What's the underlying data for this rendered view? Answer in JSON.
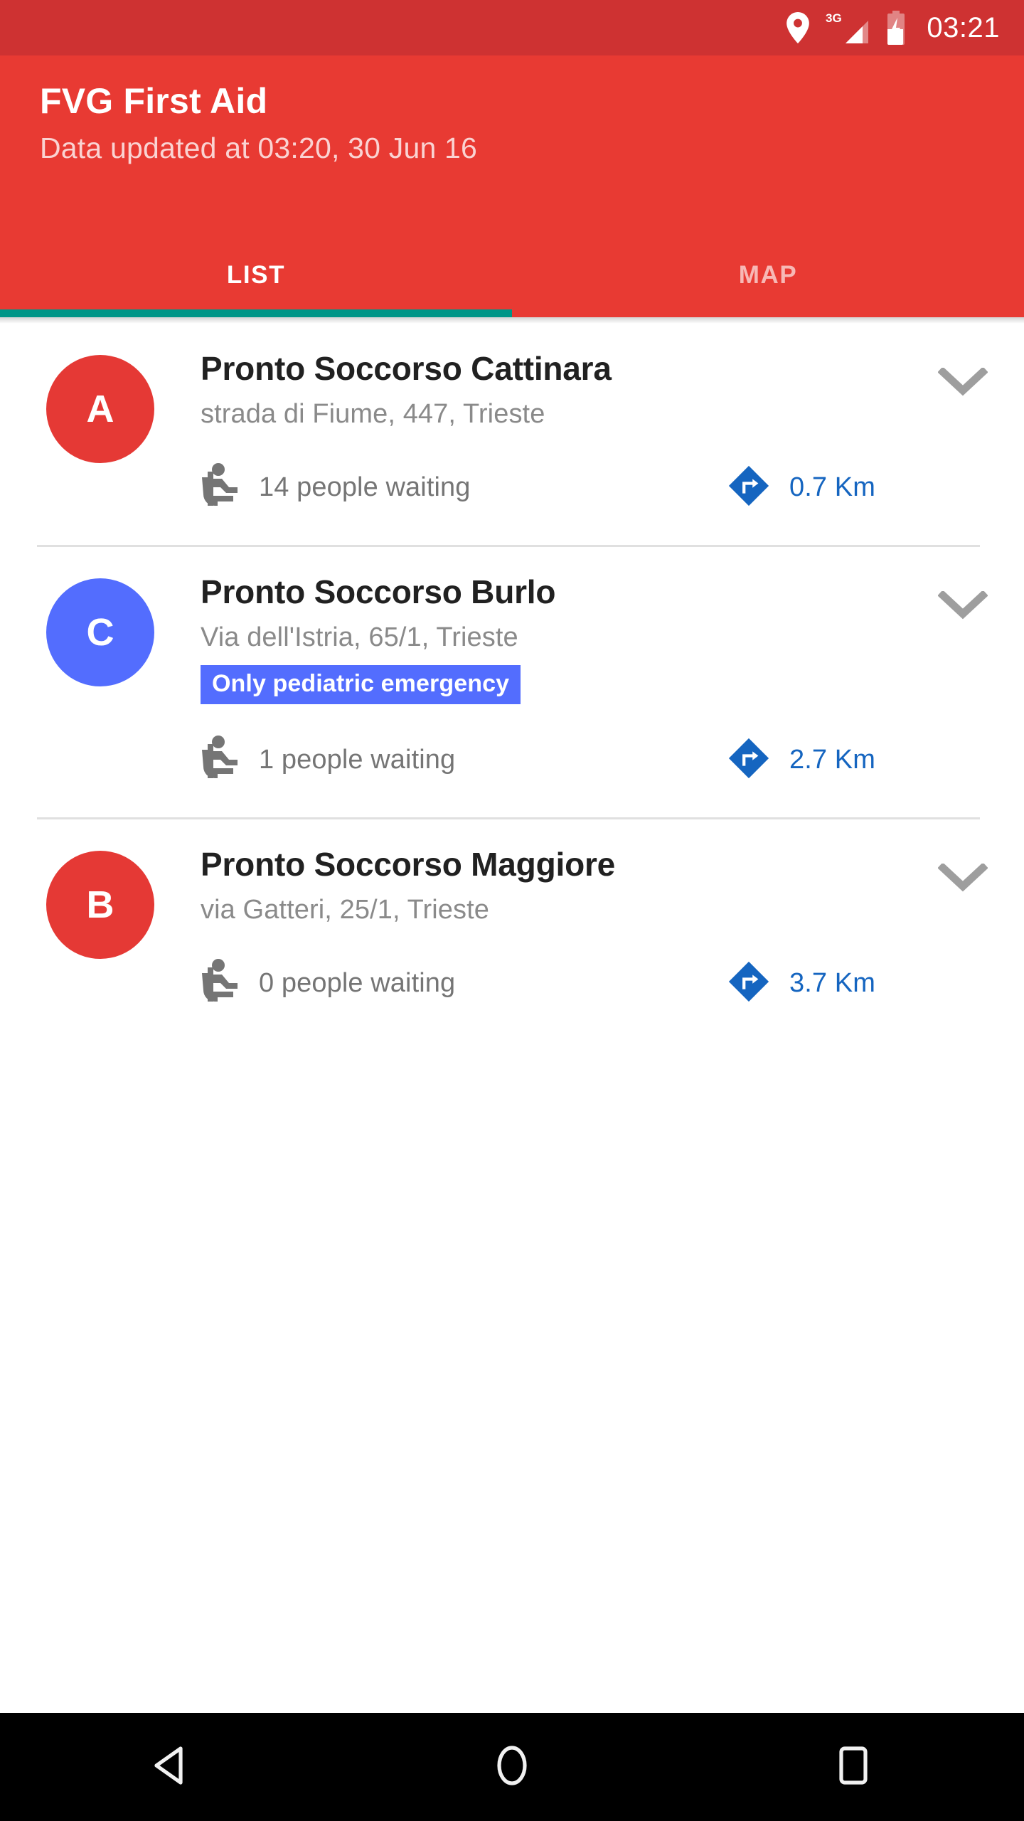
{
  "status_bar": {
    "time": "03:21",
    "network_label": "3G",
    "icons": [
      "location-pin-icon",
      "signal-3g-icon",
      "battery-charging-icon"
    ],
    "background_color": "#CE3232"
  },
  "toolbar": {
    "title": "FVG First Aid",
    "subtitle": "Data updated at 03:20, 30 Jun 16",
    "background_color": "#E83A33",
    "tabs": [
      {
        "label": "LIST",
        "active": true
      },
      {
        "label": "MAP",
        "active": false
      }
    ],
    "indicator_color": "#009688"
  },
  "list": {
    "items": [
      {
        "marker_letter": "A",
        "marker_color": "#E53935",
        "name": "Pronto Soccorso Cattinara",
        "address": "strada di Fiume, 447, Trieste",
        "badge": null,
        "badge_color": null,
        "waiting_text": "14 people waiting",
        "waiting_count": 14,
        "distance": "0.7 Km",
        "expand_icon": "chevron-down-icon"
      },
      {
        "marker_letter": "C",
        "marker_color": "#536DFE",
        "name": "Pronto Soccorso Burlo",
        "address": "Via dell'Istria, 65/1, Trieste",
        "badge": "Only pediatric emergency",
        "badge_color": "#536DFE",
        "waiting_text": "1 people waiting",
        "waiting_count": 1,
        "distance": "2.7 Km",
        "expand_icon": "chevron-down-icon"
      },
      {
        "marker_letter": "B",
        "marker_color": "#E53935",
        "name": "Pronto Soccorso Maggiore",
        "address": "via Gatteri, 25/1, Trieste",
        "badge": null,
        "badge_color": null,
        "waiting_text": "0 people waiting",
        "waiting_count": 0,
        "distance": "3.7 Km",
        "expand_icon": "chevron-down-icon"
      }
    ],
    "waiting_icon": "seated-person-icon",
    "distance_icon": "directions-diamond-icon",
    "distance_text_color": "#1565C0"
  },
  "nav_bar": {
    "background_color": "#000000",
    "buttons": [
      {
        "name": "back-button",
        "icon": "back-triangle-icon"
      },
      {
        "name": "home-button",
        "icon": "home-circle-icon"
      },
      {
        "name": "recents-button",
        "icon": "recents-square-icon"
      }
    ]
  }
}
